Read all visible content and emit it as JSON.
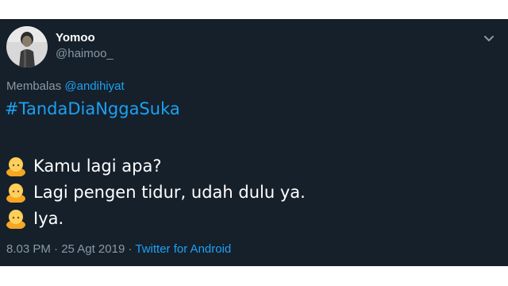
{
  "author": {
    "name": "Yomoo",
    "handle": "@haimoo_"
  },
  "reply": {
    "prefix": "Membalas",
    "mention": "@andihiyat"
  },
  "hashtag": "#TandaDiaNggaSuka",
  "lines": [
    {
      "icon": "person-emoji-icon",
      "text": "Kamu lagi apa?"
    },
    {
      "icon": "person-emoji-icon",
      "text": "Lagi pengen tidur, udah dulu ya."
    },
    {
      "icon": "person-emoji-icon",
      "text": "Iya."
    }
  ],
  "meta": {
    "time": "8.03 PM",
    "separator": "·",
    "date": "25 Agt 2019",
    "source": "Twitter for Android"
  },
  "colors": {
    "background": "#15202b",
    "text": "#ffffff",
    "secondary": "#8899a6",
    "link": "#1da1f2"
  }
}
